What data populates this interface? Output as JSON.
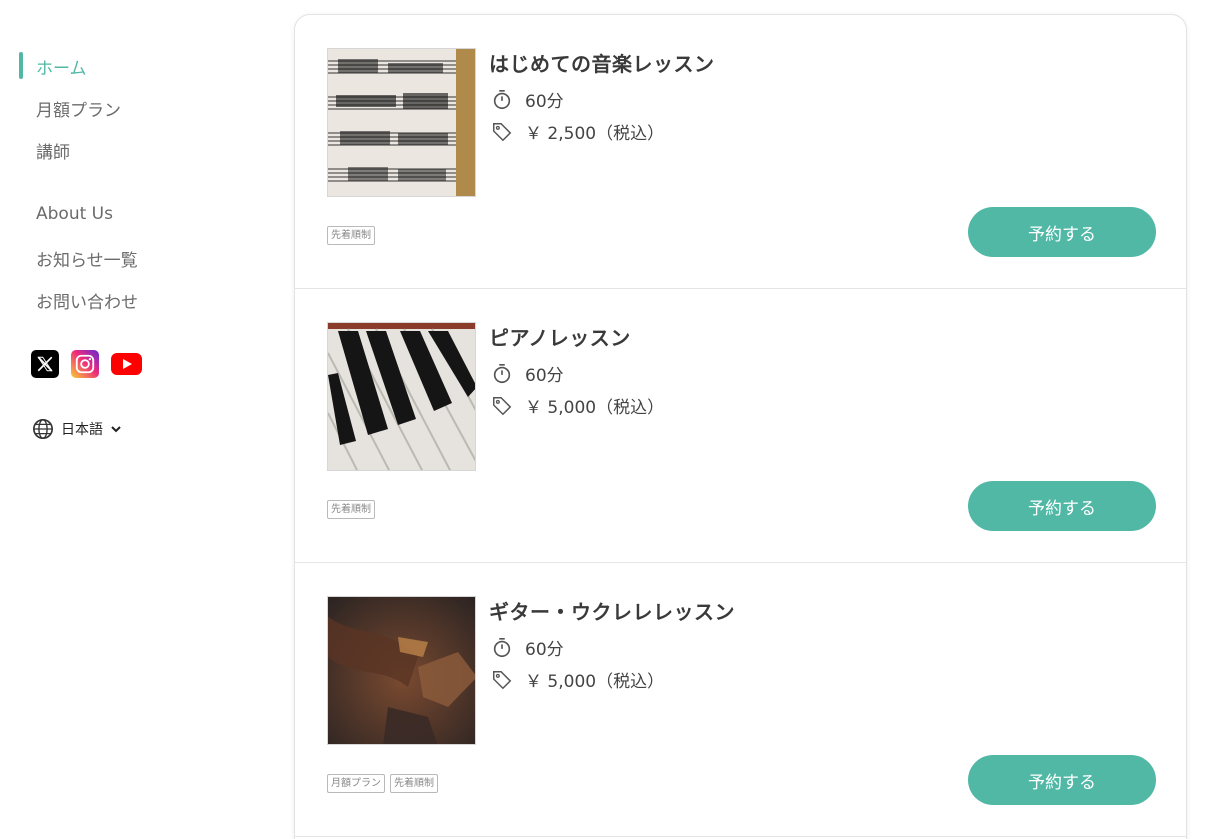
{
  "nav": {
    "primary": [
      {
        "label": "ホーム",
        "active": true
      },
      {
        "label": "月額プラン",
        "active": false
      },
      {
        "label": "講師",
        "active": false
      }
    ],
    "secondary": [
      {
        "label": "About Us"
      },
      {
        "label": "お知らせ一覧"
      },
      {
        "label": "お問い合わせ"
      }
    ],
    "social": [
      "x-icon",
      "instagram-icon",
      "youtube-icon"
    ],
    "language": "日本語"
  },
  "colors": {
    "accent": "#52b8a6",
    "text": "#3a3a3a",
    "muted": "#6b6b6b"
  },
  "lessons": [
    {
      "title": "はじめての音楽レッスン",
      "duration": "60分",
      "price": "￥ 2,500（税込）",
      "tags": [
        "先着順制"
      ],
      "button": "予約する",
      "image": "sheet-music"
    },
    {
      "title": "ピアノレッスン",
      "duration": "60分",
      "price": "￥ 5,000（税込）",
      "tags": [
        "先着順制"
      ],
      "button": "予約する",
      "image": "piano-keys"
    },
    {
      "title": "ギター・ウクレレレッスン",
      "duration": "60分",
      "price": "￥ 5,000（税込）",
      "tags": [
        "月額プラン",
        "先着順制"
      ],
      "button": "予約する",
      "image": "guitar-hands"
    }
  ]
}
